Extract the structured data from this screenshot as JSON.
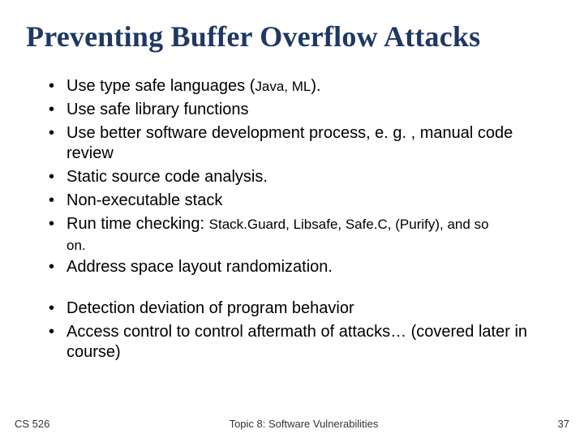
{
  "slide": {
    "title": "Preventing Buffer Overflow Attacks",
    "bullets_a": [
      {
        "pre": "Use type safe languages (",
        "sub": "Java, ML",
        "post": ")."
      },
      {
        "pre": "Use safe library functions",
        "sub": "",
        "post": ""
      },
      {
        "pre": "Use better software development process, e. g. , manual code review",
        "sub": "",
        "post": ""
      },
      {
        "pre": "Static source code analysis.",
        "sub": "",
        "post": ""
      },
      {
        "pre": "Non-executable stack",
        "sub": "",
        "post": ""
      },
      {
        "pre": "Run time checking:  ",
        "sub": "Stack.Guard, Libsafe, Safe.C, (Purify), and so",
        "post": ""
      }
    ],
    "runtime_cont": "on.",
    "bullets_b": [
      "Address space layout randomization."
    ],
    "bullets_c": [
      "Detection deviation of program behavior",
      "Access control to control aftermath of attacks… (covered later in course)"
    ],
    "footer": {
      "course": "CS 526",
      "topic": "Topic 8: Software Vulnerabilities",
      "page": "37"
    }
  }
}
